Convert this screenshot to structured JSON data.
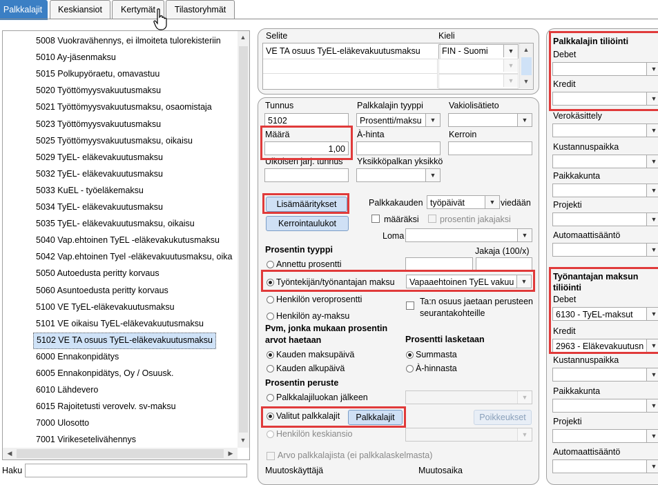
{
  "tabs": [
    "Palkkalajit",
    "Keskiansiot",
    "Kertymät",
    "Tilastoryhmät"
  ],
  "list": {
    "items": [
      "5008 Vuokravähennys, ei ilmoiteta tulorekisteriin",
      "5010 Ay-jäsenmaksu",
      "5015 Polkupyöraetu, omavastuu",
      "5020 Työttömyysvakuutusmaksu",
      "5021 Työttömyysvakuutusmaksu, osaomistaja",
      "5023 Työttömyysvakuutusmaksu",
      "5025 Työttömyysvakuutusmaksu, oikaisu",
      "5029 TyEL- eläkevakuutusmaksu",
      "5032 TyEL- eläkevakuutusmaksu",
      "5033 KuEL - työeläkemaksu",
      "5034 TyEL- eläkevakuutusmaksu",
      "5035 TyEL- eläkevakuutusmaksu, oikaisu",
      "5040 Vap.ehtoinen TyEL -eläkevakukutusmaksu",
      "5042 Vap.ehtoinen Tyel -eläkevakuutusmaksu, oika",
      "5050 Autoedusta peritty korvaus",
      "5060 Asuntoedusta peritty korvaus",
      "5100 VE TyEL-eläkevakuutusmaksu",
      "5101 VE oikaisu TyEL-eläkevakuutusmaksu",
      "5102 VE TA osuus TyEL-eläkevakuutusmaksu",
      "6000 Ennakonpidätys",
      "6005 Ennakonpidätys, Oy / Osuusk.",
      "6010 Lähdevero",
      "6015 Rajoitetusti verovelv. sv-maksu",
      "7000 Ulosotto",
      "7001 Virikesetelivähennys"
    ],
    "selected_index": 18,
    "search_label": "Haku"
  },
  "top_panel": {
    "selite_label": "Selite",
    "kieli_label": "Kieli",
    "selite_value": "VE TA osuus TyEL-eläkevakuutusmaksu",
    "kieli_value": "FIN - Suomi"
  },
  "form": {
    "tunnus_label": "Tunnus",
    "tunnus_value": "5102",
    "tyyppi_label": "Palkkalajin tyyppi",
    "tyyppi_value": "Prosentti/maksu",
    "vakio_label": "Vakiolisätieto",
    "maara_label": "Määrä",
    "maara_value": "1,00",
    "ahinta_label": "À-hinta",
    "kerroin_label": "Kerroin",
    "ulkoinen_label": "Ulkoisen järj. tunnus",
    "yksikko_label": "Yksikköpalkan yksikkö",
    "lisamaaritykset_label": "Lisämääritykset",
    "kerrointaulukot_label": "Kerrointaulukot",
    "palkkakauden_label": "Palkkakauden",
    "palkkakauden_value": "työpäivät",
    "viedaan_label": "viedään",
    "maaraksi_label": "määräksi",
    "prosentin_jakajaksi_label": "prosentin jakajaksi",
    "loma_label": "Loma",
    "prosentin_tyyppi_label": "Prosentin tyyppi",
    "jakaja_label": "Jakaja (100/x)",
    "annettu_label": "Annettu prosentti",
    "tyontekijan_label": "Työntekijän/työnantajan maksu",
    "tyontekijan_value": "Vapaaehtoinen TyEL vakuu",
    "veroprosentti_label": "Henkilön veroprosentti",
    "ta_osuus_label": "Ta:n osuus jaetaan perusteen seurantakohteille",
    "ay_maksu_label": "Henkilön ay-maksu",
    "pvm_label": "Pvm, jonka mukaan prosentin arvot haetaan",
    "prosentti_lasketaan_label": "Prosentti lasketaan",
    "kauden_maksupaiva_label": "Kauden maksupäivä",
    "summasta_label": "Summasta",
    "kauden_alkupaiva_label": "Kauden alkupäivä",
    "ahinnasta_label": "À-hinnasta",
    "prosentin_peruste_label": "Prosentin peruste",
    "palkkalajiluokan_label": "Palkkalajiluokan jälkeen",
    "valitut_label": "Valitut palkkalajit",
    "palkkalajit_button": "Palkkalajit",
    "poikkeukset_button": "Poikkeukset",
    "keskiansio_label": "Henkilön keskiansio",
    "arvo_label": "Arvo palkkalajista (ei palkkalaskelmasta)",
    "muutoskayttaja_label": "Muutoskäyttäjä",
    "muutosaika_label": "Muutosaika"
  },
  "right": {
    "tiliointi_title": "Palkkalajin tiliöinti",
    "debet_label": "Debet",
    "kredit_label": "Kredit",
    "verokasittely_label": "Verokäsittely",
    "kustannuspaikka_label": "Kustannuspaikka",
    "paikkakunta_label": "Paikkakunta",
    "projekti_label": "Projekti",
    "automaattisaanto_label": "Automaattisääntö",
    "tyonantajan_title": "Työnantajan maksun tiliöinti",
    "debet2_label": "Debet",
    "debet2_value": "6130 - TyEL-maksut",
    "kredit2_label": "Kredit",
    "kredit2_value": "2963 - Eläkevakuutusn",
    "kustannuspaikka2_label": "Kustannuspaikka",
    "paikkakunta2_label": "Paikkakunta",
    "projekti2_label": "Projekti",
    "automaattisaanto2_label": "Automaattisääntö"
  },
  "colors": {
    "highlight": "#e03a3a",
    "active_tab": "#3b7fc4",
    "button": "#cfe0f5"
  },
  "icons": [
    "hand-cursor-icon",
    "chevron-down-icon",
    "scroll-up-icon",
    "scroll-down-icon",
    "scroll-left-icon",
    "scroll-right-icon"
  ]
}
